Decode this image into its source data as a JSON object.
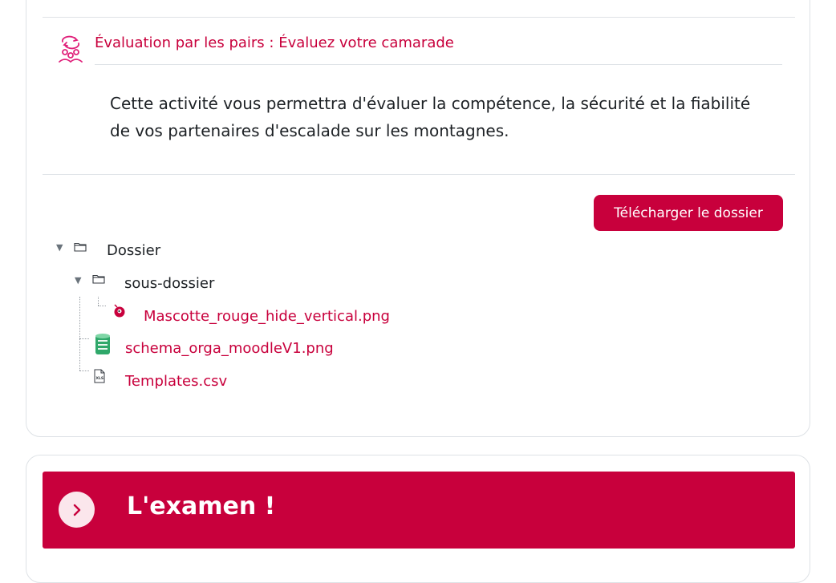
{
  "activity": {
    "title": "Évaluation par les pairs : Évaluez votre camarade",
    "description": "Cette activité vous permettra d'évaluer la compétence, la sécurité et la fiabilité de vos partenaires d'escalade sur les montagnes.",
    "icon": "peer-assessment-icon"
  },
  "folder": {
    "download_button": "Télécharger le dossier",
    "root": {
      "label": "Dossier",
      "icon": "folder-icon"
    },
    "subfolder": {
      "label": "sous-dossier",
      "icon": "folder-icon"
    },
    "files": [
      {
        "name": "Mascotte_rouge_hide_vertical.png",
        "icon": "image-icon"
      },
      {
        "name": "schema_orga_moodleV1.png",
        "icon": "image-icon"
      },
      {
        "name": "Templates.csv",
        "icon": "spreadsheet-icon"
      }
    ]
  },
  "section": {
    "title": "L'examen !",
    "toggle_icon": "chevron-right-icon"
  },
  "colors": {
    "accent": "#c8003c",
    "accent_light": "#fbe6ec",
    "border": "#dee2e6",
    "text": "#1d2125"
  }
}
